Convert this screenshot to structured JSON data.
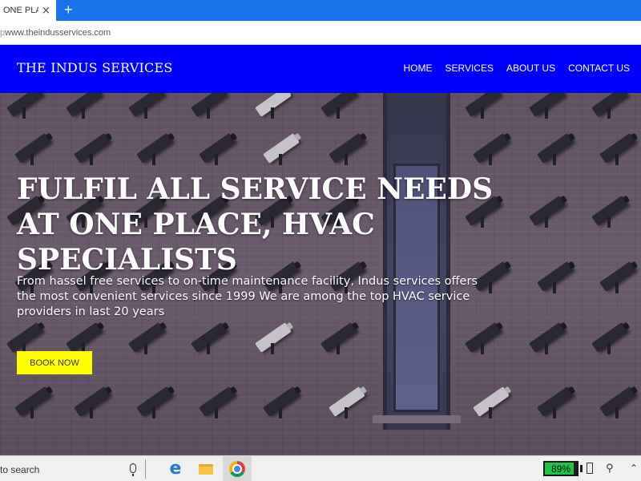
{
  "browser": {
    "tab_title": "ONE PLA",
    "tab_close": "×",
    "new_tab": "+",
    "url_prefix": "p",
    "url": "www.theindusservices.com"
  },
  "site": {
    "brand": "THE INDUS SERVICES",
    "nav": [
      "HOME",
      "SERVICES",
      "ABOUT US",
      "CONTACT US"
    ],
    "colors": {
      "navbar": "#0000ff",
      "button": "#ffff00"
    }
  },
  "hero": {
    "title": "FULFIL ALL SERVICE NEEDS AT ONE PLACE, HVAC SPECIALISTS",
    "text": "From hassel free services to on-time maintenance facility, Indus services offers the most convenient services since 1999 We are among the top HVAC service providers in last 20 years",
    "button": "BOOK NOW"
  },
  "taskbar": {
    "search": "to search",
    "apps": [
      "edge-icon",
      "file-explorer-icon",
      "chrome-icon"
    ],
    "battery_label": "89%",
    "battery_level": 0.89
  }
}
